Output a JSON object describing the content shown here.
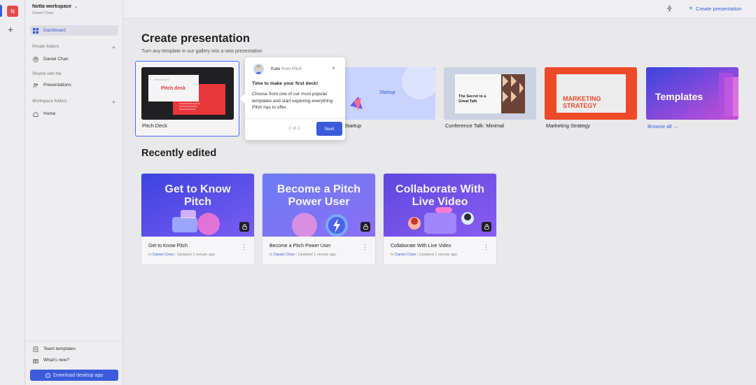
{
  "rail": {
    "avatar_letter": "N",
    "add_label": "+"
  },
  "workspace": {
    "name": "Notta workspace",
    "user": "Daniel Chan",
    "caret": "⌄"
  },
  "sidebar": {
    "dashboard": "Dashboard",
    "private_folders": "Private folders",
    "private_user": "Daniel Chan",
    "shared_with_me": "Shared with me",
    "presentations": "Presentations",
    "workspace_folders": "Workspace folders",
    "home": "Home",
    "team_templates": "Team templates",
    "whats_new": "What's new?",
    "download": "Download desktop app",
    "plus": "+"
  },
  "topbar": {
    "create_label": "Create presentation",
    "plus": "+"
  },
  "create": {
    "title": "Create presentation",
    "subtitle": "Turn any template in our gallery into a new presentation",
    "templates": [
      {
        "label": "Pitch Deck",
        "thumb_text": "Pitch deck",
        "colors": {
          "bg": "#1f1f24",
          "accent": "#e8363a"
        }
      },
      {
        "label": "Startup",
        "thumb_text": "Startup",
        "colors": {
          "bg": "#c9d3ff"
        }
      },
      {
        "label": "Conference Talk: Minimal",
        "thumb_text": "The Secret to a Great Talk",
        "colors": {
          "bg": "#cbd3e2"
        }
      },
      {
        "label": "Marketing Strategy",
        "thumb_text": "MARKETING STRATEGY",
        "colors": {
          "bg": "#ee4a2a"
        }
      },
      {
        "label": "",
        "thumb_text": "Templates",
        "colors": {
          "bg": "#4a55e8"
        }
      }
    ],
    "browse_all": "Browse all →"
  },
  "recent": {
    "title": "Recently edited",
    "items": [
      {
        "thumb_title": "Get to Know Pitch",
        "name": "Get to Know Pitch",
        "in_prefix": "In",
        "owner": "Daniel Chan",
        "updated": "Updated 1 minute ago"
      },
      {
        "thumb_title": "Become a Pitch Power User",
        "name": "Become a Pitch Power User",
        "in_prefix": "In",
        "owner": "Daniel Chan",
        "updated": "Updated 1 minute ago"
      },
      {
        "thumb_title": "Collaborate With Live Video",
        "name": "Collaborate With Live Video",
        "in_prefix": "In",
        "owner": "Daniel Chan",
        "updated": "Updated 1 minute ago"
      }
    ]
  },
  "tooltip": {
    "author": "Kate",
    "from": "from Pitch",
    "close": "×",
    "title": "Time to make your first deck!",
    "body": "Choose from one of our most popular templates and start exploring everything Pitch has to offer.",
    "step": "2 of 3",
    "next": "Next"
  },
  "colors": {
    "accent": "#3b5bdb",
    "brand_red": "#e24b4b"
  }
}
